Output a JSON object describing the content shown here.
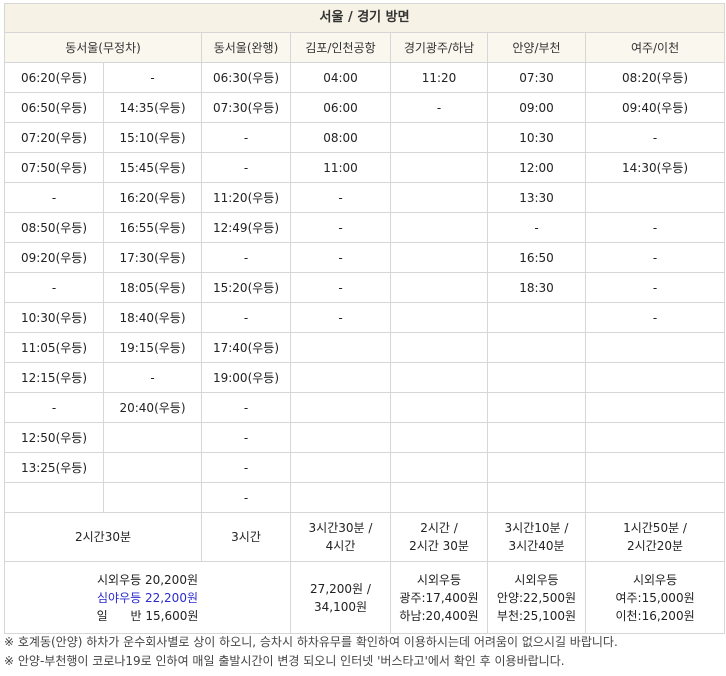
{
  "title": "서울 / 경기 방면",
  "headers": [
    "동서울(무정차)",
    "동서울(완행)",
    "김포/인천공항",
    "경기광주/하남",
    "안양/부천",
    "여주/이천"
  ],
  "rows": [
    [
      "06:20(우등)",
      "-",
      "06:30(우등)",
      "04:00",
      "11:20",
      "07:30",
      "08:20(우등)"
    ],
    [
      "06:50(우등)",
      "14:35(우등)",
      "07:30(우등)",
      "06:00",
      "-",
      "09:00",
      "09:40(우등)"
    ],
    [
      "07:20(우등)",
      "15:10(우등)",
      "-",
      "08:00",
      "",
      "10:30",
      "-"
    ],
    [
      "07:50(우등)",
      "15:45(우등)",
      "-",
      "11:00",
      "",
      "12:00",
      "14:30(우등)"
    ],
    [
      "-",
      "16:20(우등)",
      "11:20(우등)",
      "-",
      "",
      "13:30",
      ""
    ],
    [
      "08:50(우등)",
      "16:55(우등)",
      "12:49(우등)",
      "-",
      "",
      "-",
      "-"
    ],
    [
      "09:20(우등)",
      "17:30(우등)",
      "-",
      "-",
      "",
      "16:50",
      "-"
    ],
    [
      "-",
      "18:05(우등)",
      "15:20(우등)",
      "-",
      "",
      "18:30",
      "-"
    ],
    [
      "10:30(우등)",
      "18:40(우등)",
      "-",
      "-",
      "",
      "",
      "-"
    ],
    [
      "11:05(우등)",
      "19:15(우등)",
      "17:40(우등)",
      "",
      "",
      "",
      ""
    ],
    [
      "12:15(우등)",
      "-",
      "19:00(우등)",
      "",
      "",
      "",
      ""
    ],
    [
      "-",
      "20:40(우등)",
      "-",
      "",
      "",
      "",
      ""
    ],
    [
      "12:50(우등)",
      "",
      "-",
      "",
      "",
      "",
      ""
    ],
    [
      "13:25(우등)",
      "",
      "-",
      "",
      "",
      "",
      ""
    ],
    [
      "",
      "",
      "-",
      "",
      "",
      "",
      ""
    ]
  ],
  "durations": {
    "dongseoul_express": "2시간30분",
    "dongseoul_local": "3시간",
    "airport_1": "3시간30분 /",
    "airport_2": "4시간",
    "gwangju_1": "2시간 /",
    "gwangju_2": "2시간 30분",
    "anyang_1": "3시간10분 /",
    "anyang_2": "3시간40분",
    "yeoju_1": "1시간50분 /",
    "yeoju_2": "2시간20분"
  },
  "fares": {
    "dongseoul_1": "시외우등 20,200원",
    "dongseoul_2": "심야우등 22,200원",
    "dongseoul_3": "일      반 15,600원",
    "airport_1": "27,200원 /",
    "airport_2": "34,100원",
    "gwangju_1": "시외우등",
    "gwangju_2": "광주:17,400원",
    "gwangju_3": "하남:20,400원",
    "anyang_1": "시외우등",
    "anyang_2": "안양:22,500원",
    "anyang_3": "부천:25,100원",
    "yeoju_1": "시외우등",
    "yeoju_2": "여주:15,000원",
    "yeoju_3": "이천:16,200원"
  },
  "notes": [
    "※ 호계동(안양) 하차가 운수회사별로 상이 하오니, 승차시 하차유무를 확인하여 이용하시는데 어려움이 없으시길 바랍니다.",
    "※ 안양-부천행이 코로나19로 인하여 매일 출발시간이 변경 되오니 인터넷 '버스타고'에서 확인 후 이용바랍니다."
  ],
  "colors": {
    "title_bg": "#f7f2e6",
    "header_bg": "#faf7ee",
    "border": "#d6d6d6",
    "night_text": "#2b2bcc"
  }
}
